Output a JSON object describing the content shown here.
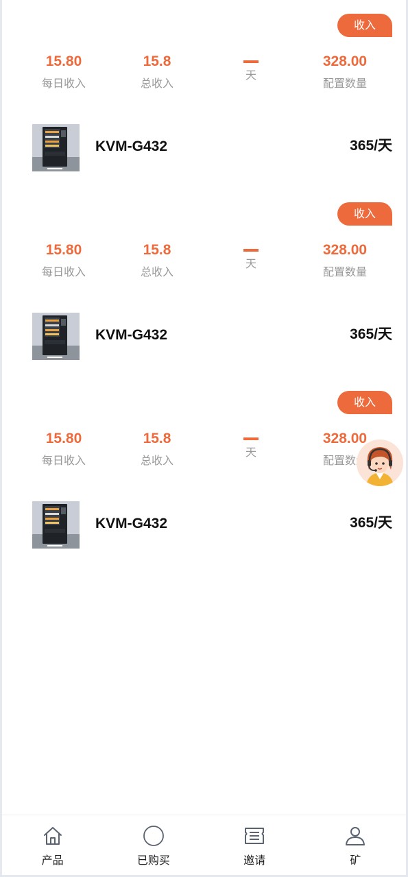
{
  "cards": [
    {
      "badge": "收入",
      "daily_income": "15.80",
      "daily_income_label": "每日收入",
      "total_income": "15.8",
      "total_income_label": "总收入",
      "days_label": "天",
      "config_qty": "328.00",
      "config_qty_label": "配置数量",
      "product_name": "KVM-G432",
      "period": "365/天"
    },
    {
      "badge": "收入",
      "daily_income": "15.80",
      "daily_income_label": "每日收入",
      "total_income": "15.8",
      "total_income_label": "总收入",
      "days_label": "天",
      "config_qty": "328.00",
      "config_qty_label": "配置数量",
      "product_name": "KVM-G432",
      "period": "365/天"
    },
    {
      "badge": "收入",
      "daily_income": "15.80",
      "daily_income_label": "每日收入",
      "total_income": "15.8",
      "total_income_label": "总收入",
      "days_label": "天",
      "config_qty": "328.00",
      "config_qty_label": "配置数量",
      "product_name": "KVM-G432",
      "period": "365/天"
    }
  ],
  "tabbar": {
    "items": [
      {
        "label": "产品",
        "icon": "home-icon"
      },
      {
        "label": "已购买",
        "icon": "circle-icon"
      },
      {
        "label": "邀请",
        "icon": "ticket-icon"
      },
      {
        "label": "矿",
        "icon": "user-icon"
      }
    ]
  },
  "colors": {
    "accent": "#ec6a3c",
    "label_gray": "#999999",
    "text": "#111111"
  }
}
